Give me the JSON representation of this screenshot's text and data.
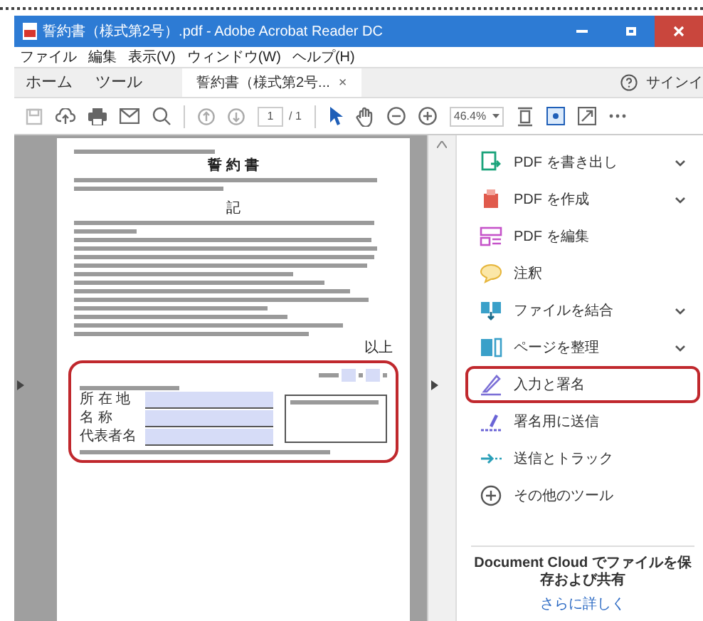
{
  "window": {
    "title": "誓約書（様式第2号）.pdf - Adobe Acrobat Reader DC"
  },
  "menu": [
    "ファイル",
    "編集",
    "表示(V)",
    "ウィンドウ(W)",
    "ヘルプ(H)"
  ],
  "tabs": [
    {
      "label": "ホーム",
      "selected": false
    },
    {
      "label": "ツール",
      "selected": false
    },
    {
      "label": "誓約書（様式第2号...",
      "selected": true,
      "close": "×"
    }
  ],
  "sign_in": "サインイ",
  "toolbar": {
    "page": "1",
    "page_total": "/ 1",
    "zoom": "46.4%"
  },
  "document": {
    "title": "誓 約 書",
    "section": "記",
    "closing": "以上",
    "form": {
      "highlighted": true,
      "fields": [
        "所 在 地",
        "名 称",
        "代表者名"
      ]
    }
  },
  "tools": [
    {
      "label": "PDF を書き出し",
      "expandable": true,
      "highlighted": false
    },
    {
      "label": "PDF を作成",
      "expandable": true,
      "highlighted": false
    },
    {
      "label": "PDF を編集",
      "expandable": false,
      "highlighted": false
    },
    {
      "label": "注釈",
      "expandable": false,
      "highlighted": false
    },
    {
      "label": "ファイルを結合",
      "expandable": true,
      "highlighted": false
    },
    {
      "label": "ページを整理",
      "expandable": true,
      "highlighted": false
    },
    {
      "label": "入力と署名",
      "expandable": false,
      "highlighted": true
    },
    {
      "label": "署名用に送信",
      "expandable": false,
      "highlighted": false
    },
    {
      "label": "送信とトラック",
      "expandable": false,
      "highlighted": false
    },
    {
      "label": "その他のツール",
      "expandable": false,
      "highlighted": false
    }
  ],
  "footer": {
    "text": "Document Cloud でファイルを保存および共有",
    "link": "さらに詳しく"
  }
}
